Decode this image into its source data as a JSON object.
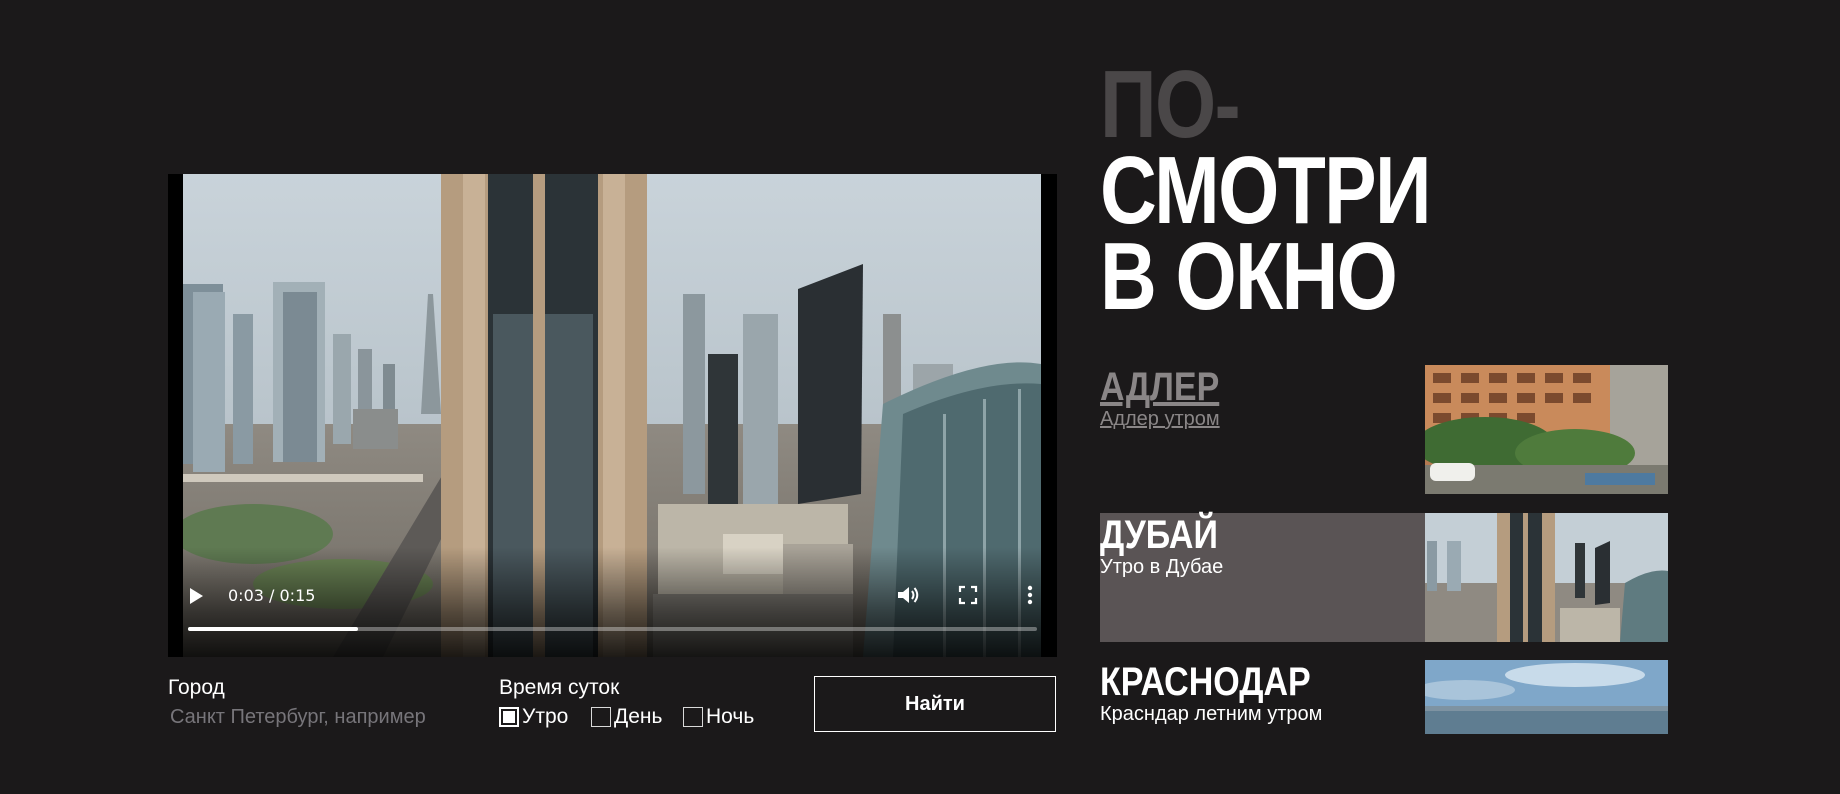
{
  "video": {
    "current_time": "0:03",
    "duration": "0:15",
    "time_display": "0:03 / 0:15",
    "progress": 0.2
  },
  "form": {
    "city_label": "Город",
    "city_placeholder": "Санкт Петербург, например",
    "time_label": "Время суток",
    "options": [
      "Утро",
      "День",
      "Ночь"
    ],
    "find_button": "Найти"
  },
  "hero": {
    "line1": "ПО-",
    "line2": "СМОТРИ",
    "line3": "В ОКНО"
  },
  "locations": [
    {
      "title": "АДЛЕР",
      "subtitle": "Адлер утром",
      "state": "visited"
    },
    {
      "title": "ДУБАЙ",
      "subtitle": "Утро в Дубае",
      "state": "active"
    },
    {
      "title": "КРАСНОДАР",
      "subtitle": "Красндар летним утром",
      "state": "default"
    }
  ],
  "colors": {
    "background": "#1b191a",
    "active_row": "#5a5455",
    "hero_dim": "#4a4748",
    "visited_text": "#8a8687"
  },
  "icons": {
    "play": "play-icon",
    "volume": "volume-icon",
    "fullscreen": "fullscreen-icon",
    "more": "more-vertical-icon"
  }
}
